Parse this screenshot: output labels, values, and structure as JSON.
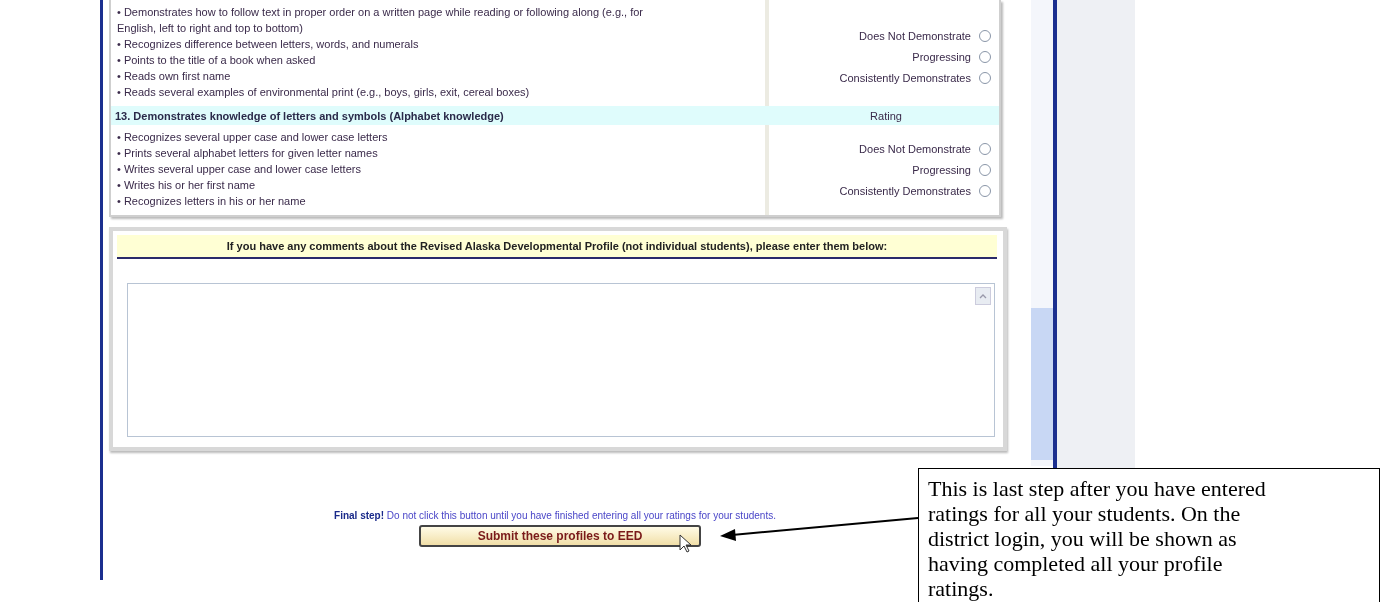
{
  "criteria": [
    {
      "bullets": [
        "• Demonstrates how to follow text in proper order on a written page while reading or following along (e.g., for English, left to right and top to bottom)",
        "• Recognizes difference between letters, words, and numerals",
        "• Points to the title of a book when asked",
        "• Reads own first name",
        "• Reads several examples of environmental print (e.g., boys, girls, exit, cereal boxes)"
      ],
      "options": [
        {
          "label": "Does Not Demonstrate",
          "selected": false
        },
        {
          "label": "Progressing",
          "selected": false
        },
        {
          "label": "Consistently Demonstrates",
          "selected": false
        }
      ]
    },
    {
      "heading": "13. Demonstrates knowledge of letters and symbols (Alphabet knowledge)",
      "rating_label": "Rating",
      "bullets": [
        "• Recognizes several upper case and lower case letters",
        "• Prints several alphabet letters for given letter names",
        "• Writes several upper case and lower case letters",
        "• Writes his or her first name",
        "• Recognizes letters in his or her name"
      ],
      "options": [
        {
          "label": "Does Not Demonstrate",
          "selected": false
        },
        {
          "label": "Progressing",
          "selected": false
        },
        {
          "label": "Consistently Demonstrates",
          "selected": false
        }
      ]
    }
  ],
  "comments": {
    "prompt": "If you have any comments about the Revised Alaska Developmental Profile (not individual students), please enter them below:"
  },
  "final_note": "**Final step!** Do not click this button until you have finished entering all your ratings for your students.",
  "submit_button": "Submit these profiles to EED",
  "callout": "This is last step after you have entered ratings for all your students. On the district login, you will be shown as having completed all your profile ratings."
}
